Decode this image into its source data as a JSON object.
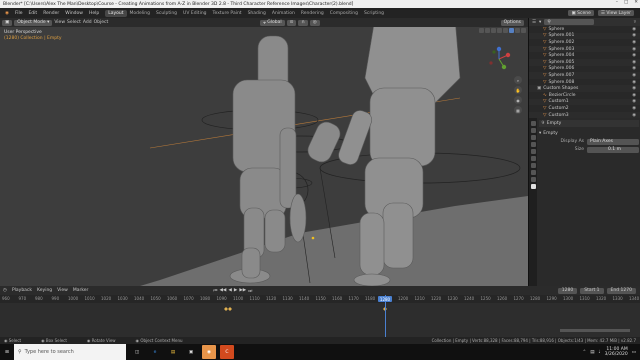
{
  "title": "Blender* [C:\\Users\\Alex The Man\\Desktop\\Course - Creating Animations from A-Z in Blender 3D 2.8 - Third Character Reference Images\\Character(2).blend]",
  "menu": [
    "File",
    "Edit",
    "Render",
    "Window",
    "Help"
  ],
  "workspaces": [
    "Layout",
    "Modeling",
    "Sculpting",
    "UV Editing",
    "Texture Paint",
    "Shading",
    "Animation",
    "Rendering",
    "Compositing",
    "Scripting"
  ],
  "active_workspace": "Layout",
  "topright": {
    "scene": "Scene",
    "view_layer": "View Layer"
  },
  "viewport": {
    "mode": "Object Mode",
    "view": "View",
    "select": "Select",
    "add": "Add",
    "object": "Object",
    "orientation": "Global",
    "options": "Options",
    "overlay_line1": "User Perspective",
    "overlay_line2": "(1280) Collection | Empty"
  },
  "outliner_items": [
    {
      "name": "Sphere",
      "icon": "mesh-icon"
    },
    {
      "name": "Sphere.001",
      "icon": "mesh-icon"
    },
    {
      "name": "Sphere.002",
      "icon": "mesh-icon"
    },
    {
      "name": "Sphere.003",
      "icon": "mesh-icon"
    },
    {
      "name": "Sphere.004",
      "icon": "mesh-icon"
    },
    {
      "name": "Sphere.005",
      "icon": "mesh-icon"
    },
    {
      "name": "Sphere.006",
      "icon": "mesh-icon"
    },
    {
      "name": "Sphere.007",
      "icon": "mesh-icon"
    },
    {
      "name": "Sphere.008",
      "icon": "mesh-icon"
    },
    {
      "name": "Custom Shapes",
      "icon": "collection-icon"
    },
    {
      "name": "BezierCircle",
      "icon": "curve-icon"
    },
    {
      "name": "Custom1",
      "icon": "mesh-icon"
    },
    {
      "name": "Custom2",
      "icon": "mesh-icon"
    },
    {
      "name": "Custom3",
      "icon": "mesh-icon"
    }
  ],
  "properties": {
    "object_name": "Empty",
    "panel": "Empty",
    "display_as_label": "Display As",
    "display_as_value": "Plain Axes",
    "size_label": "Size",
    "size_value": "0.1 m"
  },
  "timeline": {
    "playback": "Playback",
    "keying": "Keying",
    "view": "View",
    "marker": "Marker",
    "current_frame": "1280",
    "start_label": "Start",
    "start_value": "1",
    "end_label": "End",
    "end_value": "1270",
    "ticks": [
      "960",
      "970",
      "980",
      "990",
      "1000",
      "1010",
      "1020",
      "1030",
      "1040",
      "1050",
      "1060",
      "1070",
      "1080",
      "1090",
      "1100",
      "1110",
      "1120",
      "1130",
      "1140",
      "1150",
      "1160",
      "1170",
      "1180",
      "1190",
      "1200",
      "1210",
      "1220",
      "1230",
      "1240",
      "1250",
      "1260",
      "1270",
      "1280",
      "1290",
      "1300",
      "1310",
      "1320",
      "1330",
      "1340"
    ]
  },
  "statusbar": {
    "select": "Select",
    "box_select": "Box Select",
    "rotate_view": "Rotate View",
    "context_menu": "Object Context Menu",
    "stats": "Collection | Empty | Verts:88,328 | Faces:88,794 | Tris:88,916 | Objects:1/43 | Mem: 42.7 MiB | v2.82.7"
  },
  "taskbar": {
    "search_placeholder": "Type here to search",
    "time": "11:00 AM",
    "date": "3/26/2020"
  }
}
